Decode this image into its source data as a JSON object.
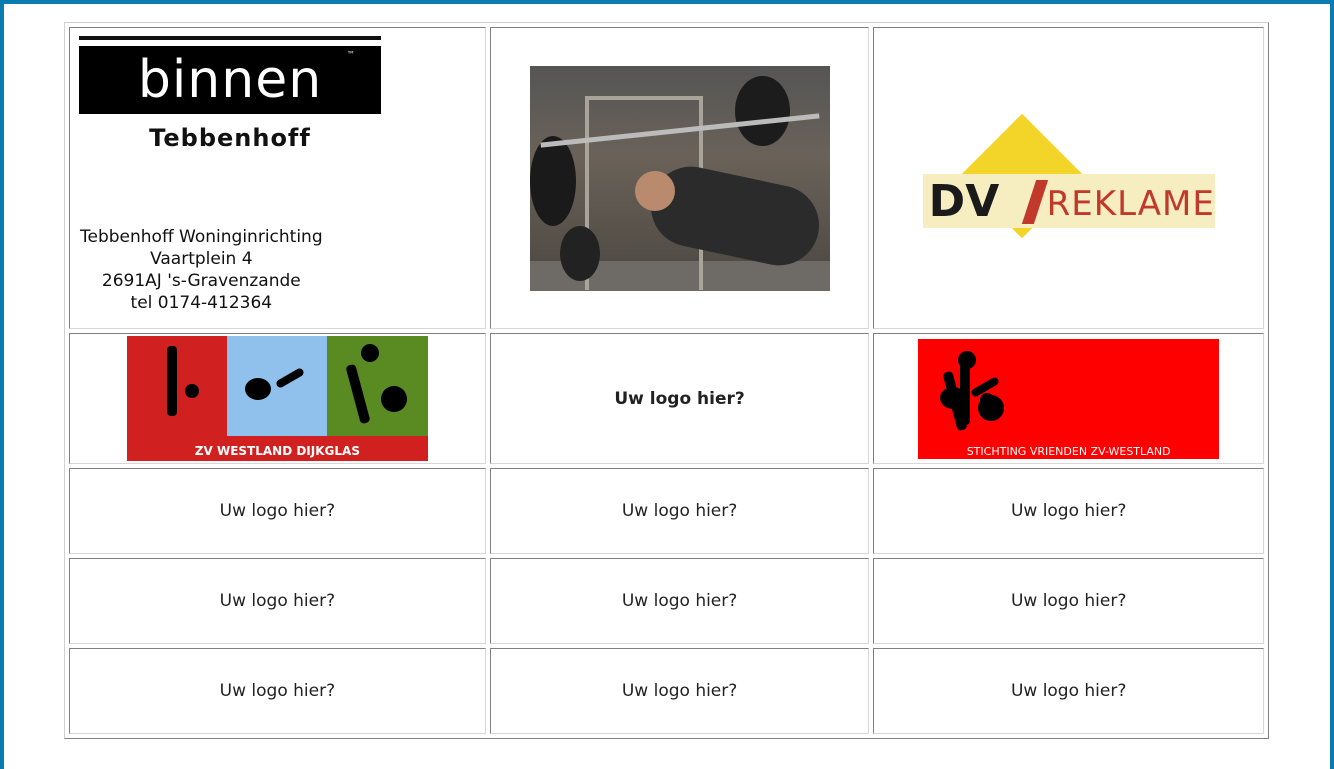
{
  "sponsors": {
    "tebbenhoff": {
      "logo_word": "binnen",
      "logo_tm": "™",
      "logo_sub": "Tebbenhoff",
      "address": [
        "Tebbenhoff Woninginrichting",
        "Vaartplein 4",
        "2691AJ 's-Gravenzande",
        "tel 0174-412364"
      ]
    },
    "dvi": {
      "mark": "DV",
      "word": "REKLAME"
    },
    "zv_westland": {
      "label": "ZV WESTLAND DIJKGLAS"
    },
    "featured_placeholder": "Uw logo hier?",
    "vrienden": {
      "label": "STICHTING VRIENDEN ZV-WESTLAND"
    },
    "placeholders": [
      [
        "Uw logo hier?",
        "Uw logo hier?",
        "Uw logo hier?"
      ],
      [
        "Uw logo hier?",
        "Uw logo hier?",
        "Uw logo hier?"
      ],
      [
        "Uw logo hier?",
        "Uw logo hier?",
        "Uw logo hier?"
      ]
    ]
  },
  "colors": {
    "frame": "#0a7cb0",
    "zv_red": "#d0201f",
    "zv_blue": "#8fc1ec",
    "zv_green": "#5a8a22",
    "vrienden_red": "#ff0000",
    "dvi_yellow": "#f3d52a"
  }
}
